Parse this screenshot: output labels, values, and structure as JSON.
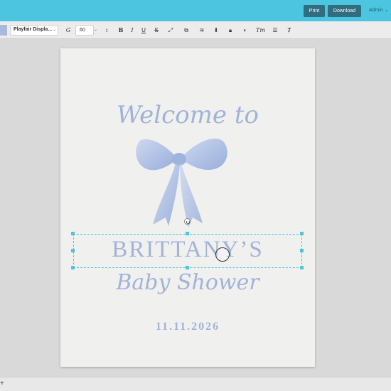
{
  "topbar": {
    "print_label": "Print",
    "download_label": "Download",
    "user_label": "Admin ⌄"
  },
  "toolbar": {
    "font_name": "Playfair Displa...",
    "font_size": "60",
    "icons": [
      "text-effect-icon",
      "line-height-icon",
      "bold-icon",
      "italic-icon",
      "underline-icon",
      "strikethrough-icon",
      "resize-icon",
      "duplicate-icon",
      "layers-icon",
      "download-icon",
      "lock-icon",
      "color-icon",
      "case-icon",
      "list-icon",
      "clear-format-icon"
    ]
  },
  "canvas": {
    "welcome": "Welcome to",
    "name": "BRITTANY’S",
    "subtitle": "Baby Shower",
    "date": "11.11.2026",
    "text_color": "#a2b3d8"
  },
  "bottom": {
    "add_label": "+"
  },
  "colors": {
    "accent": "#4cc5e0",
    "button": "#2f6d7f"
  }
}
